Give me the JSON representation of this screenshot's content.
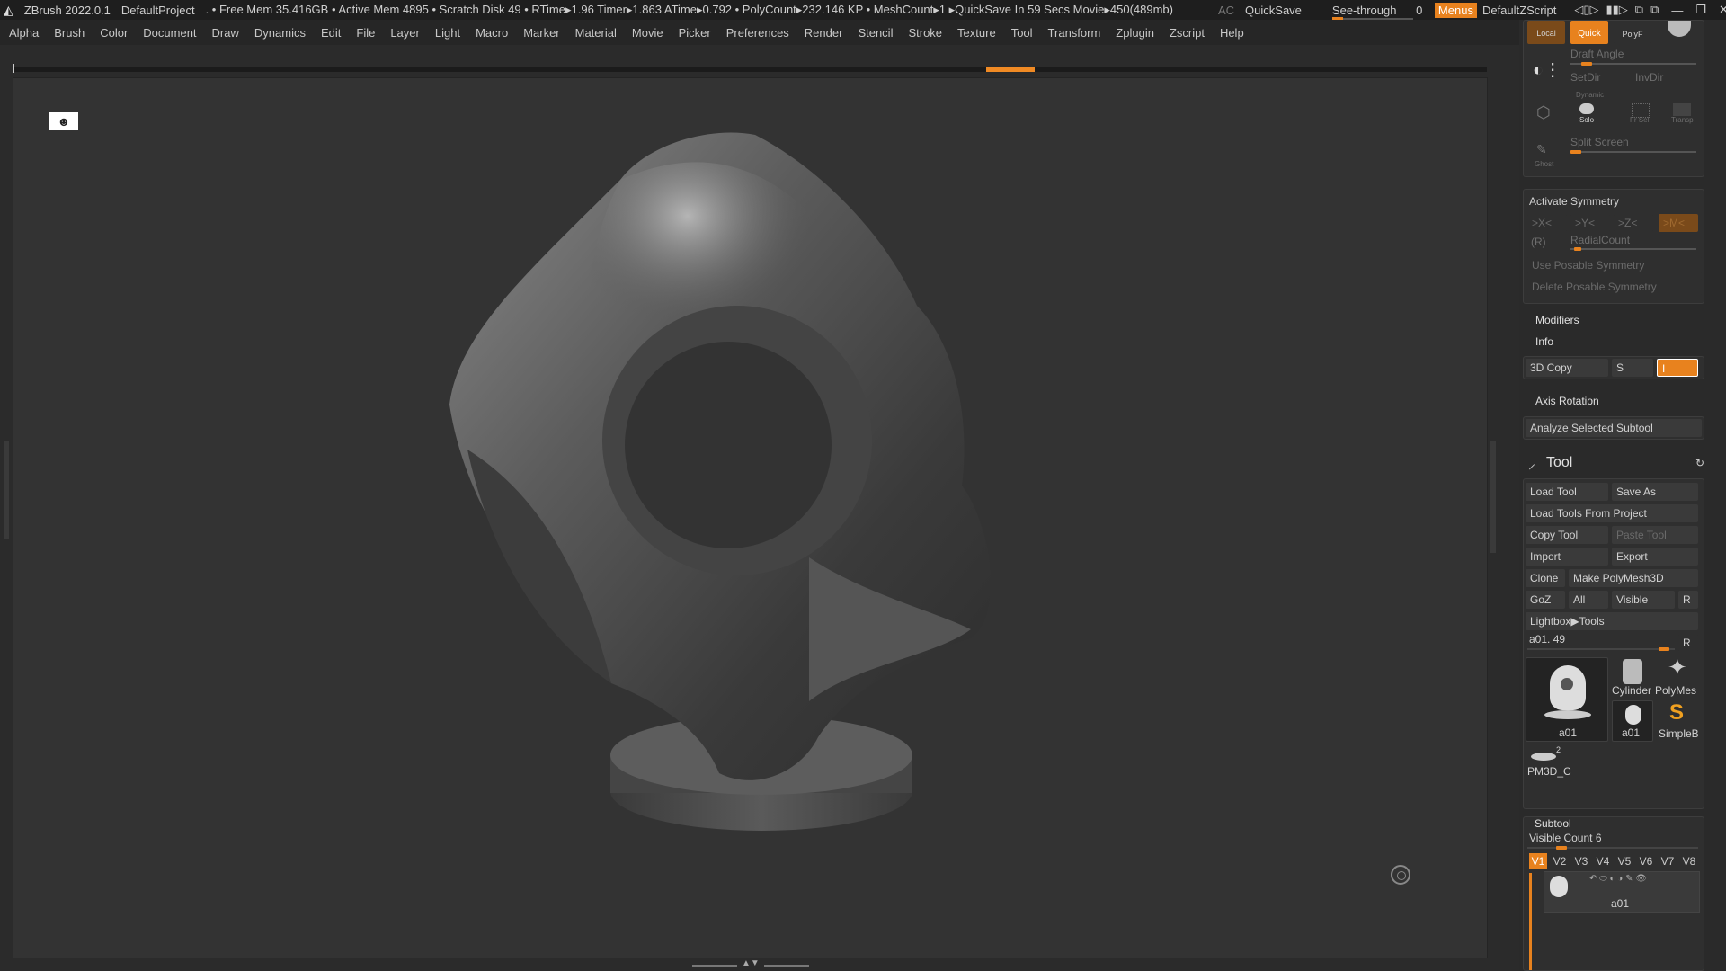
{
  "titlebar": {
    "app": "ZBrush 2022.0.1",
    "project": "DefaultProject",
    "stats": ". • Free Mem 35.416GB • Active Mem 4895 • Scratch Disk 49 •  RTime▸1.96 Timer▸1.863 ATime▸0.792 • PolyCount▸232.146 KP  • MeshCount▸1  ▸QuickSave In 59 Secs Movie▸450(489mb)",
    "ac": "AC",
    "quicksave": "QuickSave",
    "see_through_label": "See-through",
    "see_through_value": "0",
    "menus": "Menus",
    "script": "DefaultZScript"
  },
  "menubar": {
    "items": [
      "Alpha",
      "Brush",
      "Color",
      "Document",
      "Draw",
      "Dynamics",
      "Edit",
      "File",
      "Layer",
      "Light",
      "Macro",
      "Marker",
      "Material",
      "Movie",
      "Picker",
      "Preferences",
      "Render",
      "Stencil",
      "Stroke",
      "Texture",
      "Tool",
      "Transform",
      "Zplugin",
      "Zscript",
      "Help"
    ]
  },
  "topbox": {
    "local": "Local",
    "quick": "Quick",
    "polyf": "PolyF",
    "draft_angle": "Draft Angle",
    "setdir": "SetDir",
    "invdir": "InvDir",
    "dynamic": "Dynamic",
    "solo": "Solo",
    "frsel": "Fr Sel",
    "transp": "Transp",
    "split_screen": "Split Screen",
    "ghost": "Ghost"
  },
  "symmetry": {
    "activate": "Activate Symmetry",
    "x": ">X<",
    "y": ">Y<",
    "z": ">Z<",
    "m": ">M<",
    "r": "(R)",
    "radial": "RadialCount",
    "posable": "Use Posable Symmetry",
    "delete_posable": "Delete Posable Symmetry"
  },
  "sections": {
    "modifiers": "Modifiers",
    "info": "Info",
    "copy3d": "3D Copy",
    "s": "S",
    "axis_rotation": "Axis Rotation",
    "analyze": "Analyze Selected Subtool"
  },
  "tool": {
    "title": "Tool",
    "load_tool": "Load Tool",
    "save_as": "Save As",
    "load_from_project": "Load Tools From Project",
    "copy_tool": "Copy Tool",
    "paste_tool": "Paste Tool",
    "import": "Import",
    "export": "Export",
    "clone": "Clone",
    "make_polymesh": "Make PolyMesh3D",
    "goz": "GoZ",
    "all": "All",
    "visible": "Visible",
    "r": "R",
    "lightbox": "Lightbox▶Tools",
    "current": "a01. 49",
    "thumbs": [
      "a01",
      "Cylinder",
      "PolyMes",
      "a01",
      "SimpleB",
      "PM3D_C"
    ],
    "pm3d_count": "2"
  },
  "subtool": {
    "title": "Subtool",
    "visible_count": "Visible Count 6",
    "tabs": [
      "V1",
      "V2",
      "V3",
      "V4",
      "V5",
      "V6",
      "V7",
      "V8"
    ],
    "item_name": "a01"
  }
}
